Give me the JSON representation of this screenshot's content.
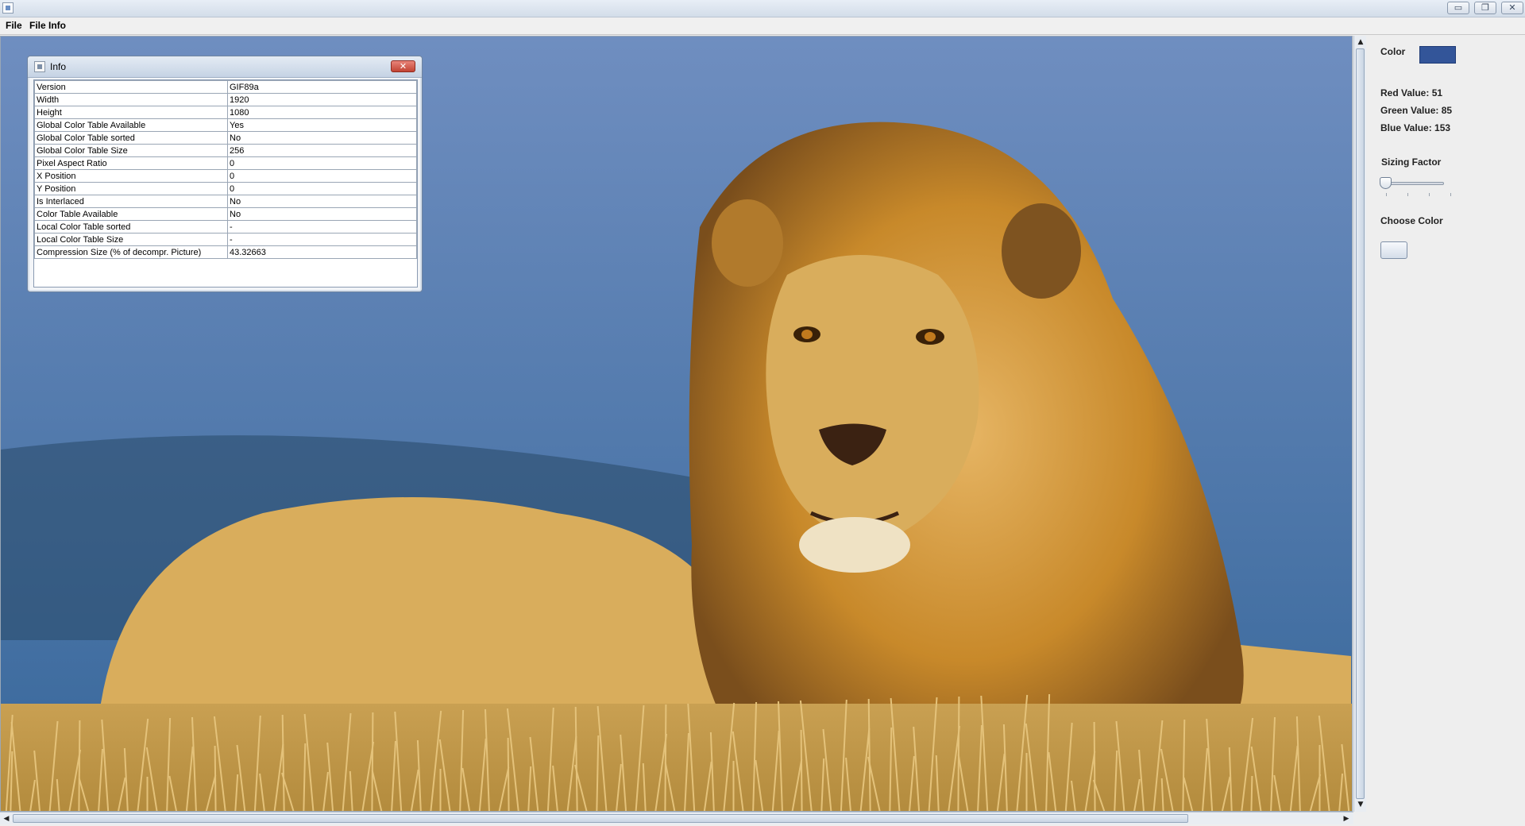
{
  "window": {
    "minimize_glyph": "▭",
    "restore_glyph": "❐",
    "close_glyph": "✕"
  },
  "menu": {
    "items": [
      "File",
      "File Info"
    ]
  },
  "info_frame": {
    "title": "Info",
    "close_glyph": "✕",
    "rows": [
      {
        "key": "Version",
        "value": "GIF89a"
      },
      {
        "key": "Width",
        "value": "1920"
      },
      {
        "key": "Height",
        "value": "1080"
      },
      {
        "key": "Global Color Table Available",
        "value": "Yes"
      },
      {
        "key": "Global Color Table sorted",
        "value": "No"
      },
      {
        "key": "Global Color Table Size",
        "value": "256"
      },
      {
        "key": "Pixel Aspect Ratio",
        "value": "0"
      },
      {
        "key": "X Position",
        "value": "0"
      },
      {
        "key": "Y Position",
        "value": "0"
      },
      {
        "key": "Is Interlaced",
        "value": "No"
      },
      {
        "key": "Color Table Available",
        "value": "No"
      },
      {
        "key": "Local Color Table sorted",
        "value": "-"
      },
      {
        "key": "Local Color Table Size",
        "value": "-"
      },
      {
        "key": "Compression Size (% of decompr. Picture)",
        "value": "43.32663"
      }
    ]
  },
  "panel": {
    "color_label": "Color",
    "color_value": "#335599",
    "red_label": "Red Value: 51",
    "green_label": "Green Value: 85",
    "blue_label": "Blue Value: 153",
    "sizing_label": "Sizing Factor",
    "sizing_level": 0,
    "choose_label": "Choose Color"
  },
  "image": {
    "sky_top": "#6f8ec0",
    "sky_bottom": "#37679a",
    "ground": "#b38b3d",
    "mane": "#c8892a",
    "fur": "#d9ad5c"
  }
}
